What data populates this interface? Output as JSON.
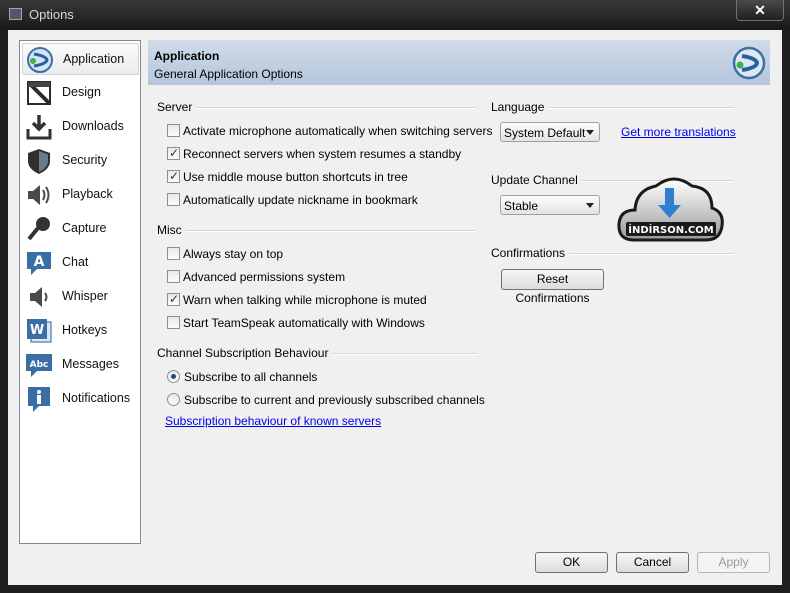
{
  "window": {
    "title": "Options",
    "close_glyph": "✕"
  },
  "sidebar": {
    "items": [
      {
        "label": "Application",
        "icon": "teamspeak-logo-icon",
        "selected": true
      },
      {
        "label": "Design",
        "icon": "design-icon"
      },
      {
        "label": "Downloads",
        "icon": "download-icon"
      },
      {
        "label": "Security",
        "icon": "shield-icon"
      },
      {
        "label": "Playback",
        "icon": "speaker-icon"
      },
      {
        "label": "Capture",
        "icon": "microphone-icon"
      },
      {
        "label": "Chat",
        "icon": "chat-icon"
      },
      {
        "label": "Whisper",
        "icon": "whisper-speaker-icon"
      },
      {
        "label": "Hotkeys",
        "icon": "hotkeys-icon"
      },
      {
        "label": "Messages",
        "icon": "messages-icon"
      },
      {
        "label": "Notifications",
        "icon": "info-icon"
      }
    ]
  },
  "header": {
    "title": "Application",
    "subtitle": "General Application Options"
  },
  "server": {
    "label": "Server",
    "options": [
      {
        "label": "Activate microphone automatically when switching servers",
        "checked": false
      },
      {
        "label": "Reconnect servers when system resumes a standby",
        "checked": true
      },
      {
        "label": "Use middle mouse button shortcuts in tree",
        "checked": true
      },
      {
        "label": "Automatically update nickname in bookmark",
        "checked": false
      }
    ]
  },
  "misc": {
    "label": "Misc",
    "options": [
      {
        "label": "Always stay on top",
        "checked": false
      },
      {
        "label": "Advanced permissions system",
        "checked": false
      },
      {
        "label": "Warn when talking while microphone is muted",
        "checked": true
      },
      {
        "label": "Start TeamSpeak automatically with Windows",
        "checked": false
      }
    ]
  },
  "subscription": {
    "label": "Channel Subscription Behaviour",
    "options": [
      {
        "label": "Subscribe to all channels",
        "checked": true
      },
      {
        "label": "Subscribe to current and previously subscribed channels",
        "checked": false
      }
    ],
    "link": "Subscription behaviour of known servers"
  },
  "language": {
    "label": "Language",
    "value": "System Default",
    "link": "Get more translations"
  },
  "update_channel": {
    "label": "Update Channel",
    "value": "Stable"
  },
  "confirmations": {
    "label": "Confirmations",
    "button": "Reset Confirmations"
  },
  "watermark": {
    "text": "İNDİRSON.COM"
  },
  "footer": {
    "ok": "OK",
    "cancel": "Cancel",
    "apply": "Apply"
  },
  "colors": {
    "header_bg": "#c3d2e4",
    "link": "#0000ee",
    "ts_blue": "#2a5f9e"
  }
}
